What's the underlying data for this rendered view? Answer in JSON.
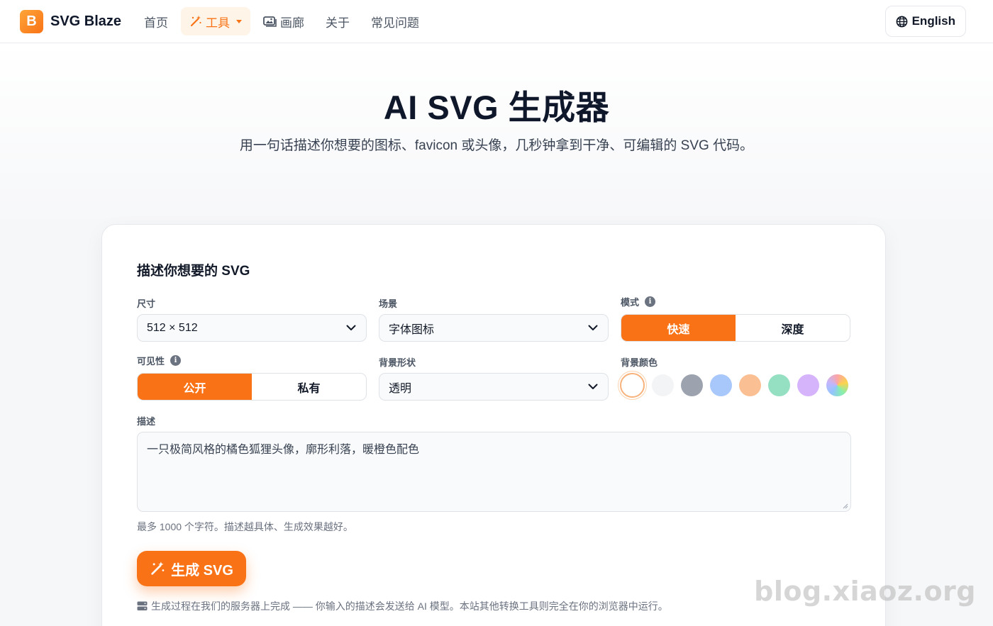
{
  "header": {
    "brand": {
      "logo_letter": "B",
      "name": "SVG Blaze"
    },
    "nav": [
      {
        "label": "首页",
        "icon": ""
      },
      {
        "label": "工具",
        "icon": "magic-wand-icon",
        "active": true
      },
      {
        "label": "画廊",
        "icon": "image-gallery-icon"
      },
      {
        "label": "关于",
        "icon": ""
      },
      {
        "label": "常见问题",
        "icon": ""
      }
    ],
    "language": {
      "label": "English",
      "icon": "globe-icon"
    }
  },
  "hero": {
    "title": "AI SVG 生成器",
    "subtitle": "用一句话描述你想要的图标、favicon 或头像，几秒钟拿到干净、可编辑的 SVG 代码。"
  },
  "form": {
    "title": "描述你想要的 SVG",
    "size": {
      "label": "尺寸",
      "value": "512 × 512"
    },
    "scene": {
      "label": "场景",
      "value": "字体图标"
    },
    "mode": {
      "label": "模式",
      "options": [
        "快速",
        "深度"
      ],
      "selected": "快速"
    },
    "visibility": {
      "label": "可见性",
      "options": [
        "公开",
        "私有"
      ],
      "selected": "公开"
    },
    "bg_shape": {
      "label": "背景形状",
      "value": "透明"
    },
    "bg_color": {
      "label": "背景颜色",
      "swatches": [
        "#ffffff",
        "#f3f4f6",
        "#9ca3af",
        "#a8c7fa",
        "#fbbf94",
        "#95e0c2",
        "#d6b4fb",
        "rainbow"
      ],
      "selected_index": 0
    },
    "description": {
      "label": "描述",
      "value": "一只极简风格的橘色狐狸头像，廓形利落，暖橙色配色",
      "hint": "最多 1000 个字符。描述越具体、生成效果越好。"
    },
    "generate_label": "生成 SVG",
    "footnote": "生成过程在我们的服务器上完成 —— 你输入的描述会发送给 AI 模型。本站其他转换工具则完全在你的浏览器中运行。"
  },
  "watermark": "blog.xiaoz.org",
  "colors": {
    "accent": "#f97316",
    "accent_soft": "#fff4e8"
  }
}
